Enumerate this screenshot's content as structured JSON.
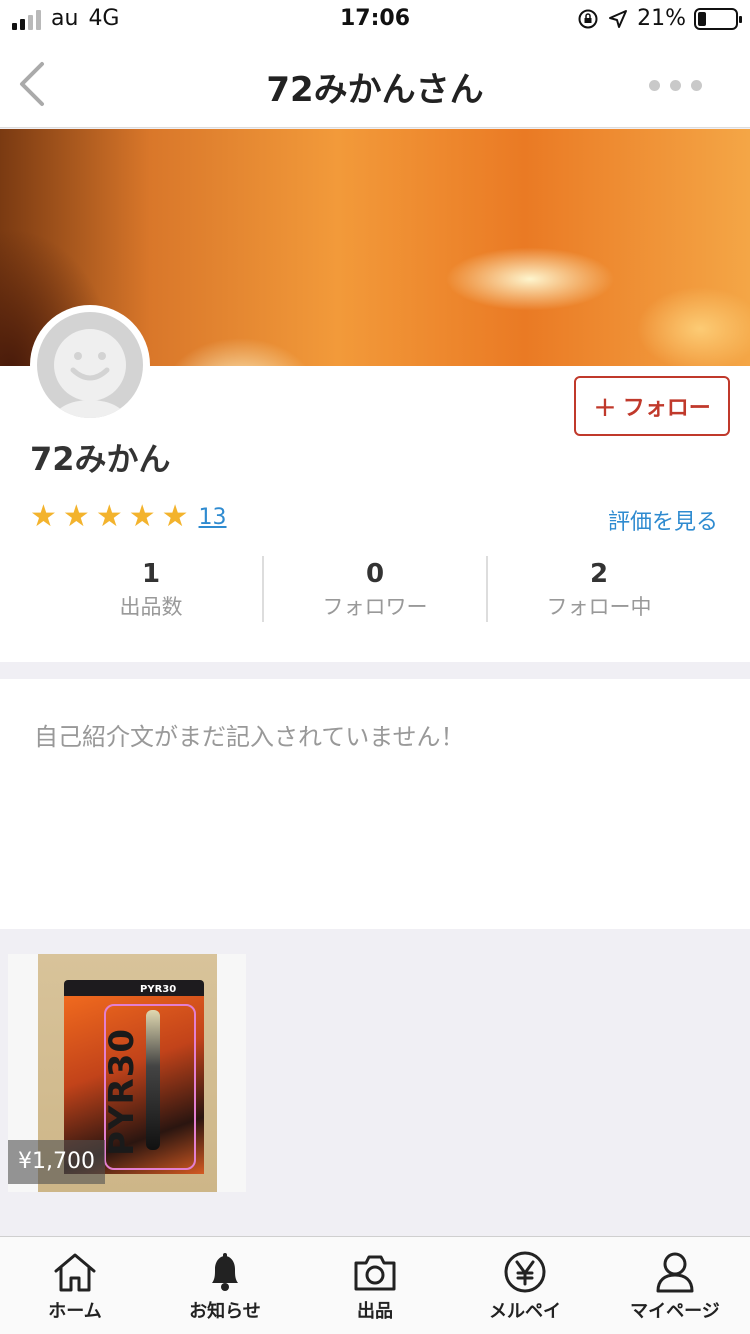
{
  "status": {
    "carrier": "au",
    "network": "4G",
    "time": "17:06",
    "battery": "21%",
    "battery_level": 0.21
  },
  "nav": {
    "title": "72みかんさん"
  },
  "profile": {
    "follow_label": "フォロー",
    "name": "72みかん",
    "rating_stars": 5,
    "review_count": "13",
    "see_reviews": "評価を見る",
    "stats": [
      {
        "value": "1",
        "label": "出品数"
      },
      {
        "value": "0",
        "label": "フォロワー"
      },
      {
        "value": "2",
        "label": "フォロー中"
      }
    ]
  },
  "bio": {
    "text": "自己紹介文がまだ記入されていません！"
  },
  "items": [
    {
      "price": "¥1,700",
      "box_brand": "PYR30",
      "box_vertical_text": "PYR30"
    }
  ],
  "tabbar": {
    "tabs": [
      {
        "label": "ホーム",
        "icon": "home-icon"
      },
      {
        "label": "お知らせ",
        "icon": "bell-icon"
      },
      {
        "label": "出品",
        "icon": "camera-icon"
      },
      {
        "label": "メルペイ",
        "icon": "yen-icon"
      },
      {
        "label": "マイページ",
        "icon": "person-icon"
      }
    ]
  },
  "colors": {
    "accent": "#c0392b",
    "link": "#2f8bd0",
    "star": "#f3b32d"
  }
}
